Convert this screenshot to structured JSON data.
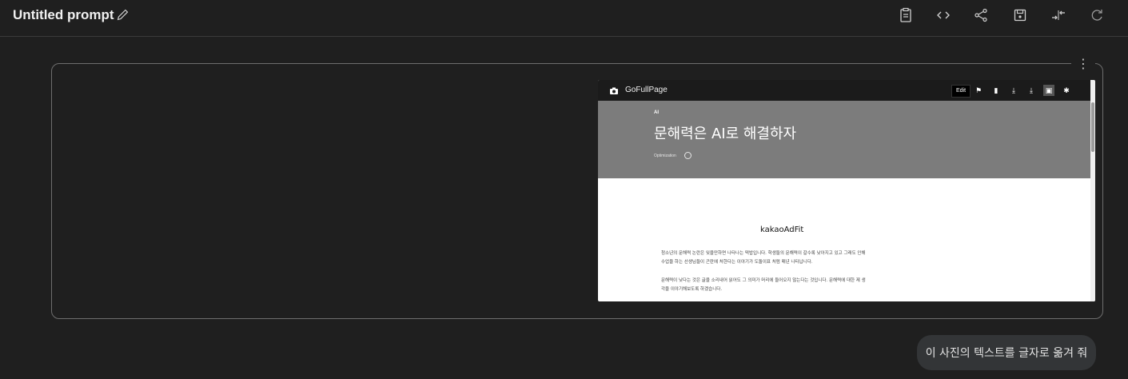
{
  "header": {
    "title": "Untitled prompt",
    "icons": [
      "pencil-icon",
      "clipboard-icon",
      "code-icon",
      "share-icon",
      "save-icon",
      "compare-icon",
      "refresh-icon"
    ]
  },
  "card": {
    "more_icon": "⋮",
    "screenshot": {
      "toolbar": {
        "app_name": "GoFullPage",
        "edit_label": "Edit",
        "buttons": [
          "flag-icon",
          "trash-icon",
          "download-icon",
          "download-icon",
          "save-icon",
          "settings-icon"
        ]
      },
      "hero": {
        "category": "AI",
        "title": "문해력은 AI로 해결하자",
        "meta": "Optimization"
      },
      "ad_label": "kakaoAdFit",
      "paragraphs": [
        "청소년의 문해력 논란은 잊을만하면 나타나는 떡밥입니다. 학생들의 문해력이 갈수록 낮아지고 있고 그래도 인해",
        "수업을 하는 선생님들이 곤란에 처한다는 이야기가 도돌이표 처럼 매년 나타납니다.",
        "문해력이 낮다는 것은 글을 소리내어 읽어도 그 의미가 머리에 들어오지 않는다는 것입니다. 문해력에 대한 제 생",
        "각을 이야기해보도록 하겠습니다."
      ]
    }
  },
  "prompt_chip": {
    "text": "이 사진의 텍스트를 글자로 옮겨 줘"
  }
}
